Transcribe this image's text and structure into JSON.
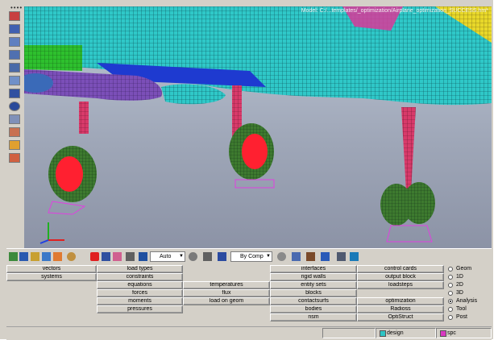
{
  "viewport": {
    "model_title": "Model: C:/...templates/_optimization/Airplane_optimization_SUCCESS.hm*",
    "colors": {
      "background_top": "#bdc6d4",
      "fuselage_mesh": "#2fc8c8",
      "missile": "#7b4fb8",
      "landing_gear_strut": "#d83a6a",
      "tire": "#3d7a2f",
      "wheel_hub": "#ff2030",
      "wing_green": "#2ec02e",
      "tail_yellow": "#e8d82a"
    }
  },
  "left_toolbar": {
    "icons": [
      "view-icon",
      "orient-icon",
      "fit-icon",
      "rotate-icon",
      "zoom-icon",
      "pan-icon",
      "hidden-line-icon",
      "info-icon",
      "collector-icon",
      "display-icon",
      "color-icon",
      "mask-icon"
    ]
  },
  "bottom_toolbar": {
    "auto_combo": "Auto",
    "by_comp_combo": "By Comp"
  },
  "panel": {
    "col1": [
      "vectors",
      "systems"
    ],
    "col2": [
      "load types",
      "constraints",
      "equations",
      "forces",
      "moments",
      "pressures"
    ],
    "col3": [
      "temperatures",
      "flux",
      "load on geom"
    ],
    "col4": [
      "interfaces",
      "rigid walls",
      "entity sets",
      "blocks",
      "contactsurfs",
      "bodies",
      "nsm"
    ],
    "col5": [
      "control cards",
      "output block",
      "loadsteps",
      "optimization",
      "Radioss",
      "OptiStruct"
    ],
    "radios": [
      {
        "label": "Geom",
        "selected": false
      },
      {
        "label": "1D",
        "selected": false
      },
      {
        "label": "2D",
        "selected": false
      },
      {
        "label": "3D",
        "selected": false
      },
      {
        "label": "Analysis",
        "selected": true
      },
      {
        "label": "Tool",
        "selected": false
      },
      {
        "label": "Post",
        "selected": false
      }
    ]
  },
  "status_bar": {
    "design": "design",
    "spc": "spc",
    "design_color": "#2ec4c4",
    "spc_color": "#d838c0"
  }
}
